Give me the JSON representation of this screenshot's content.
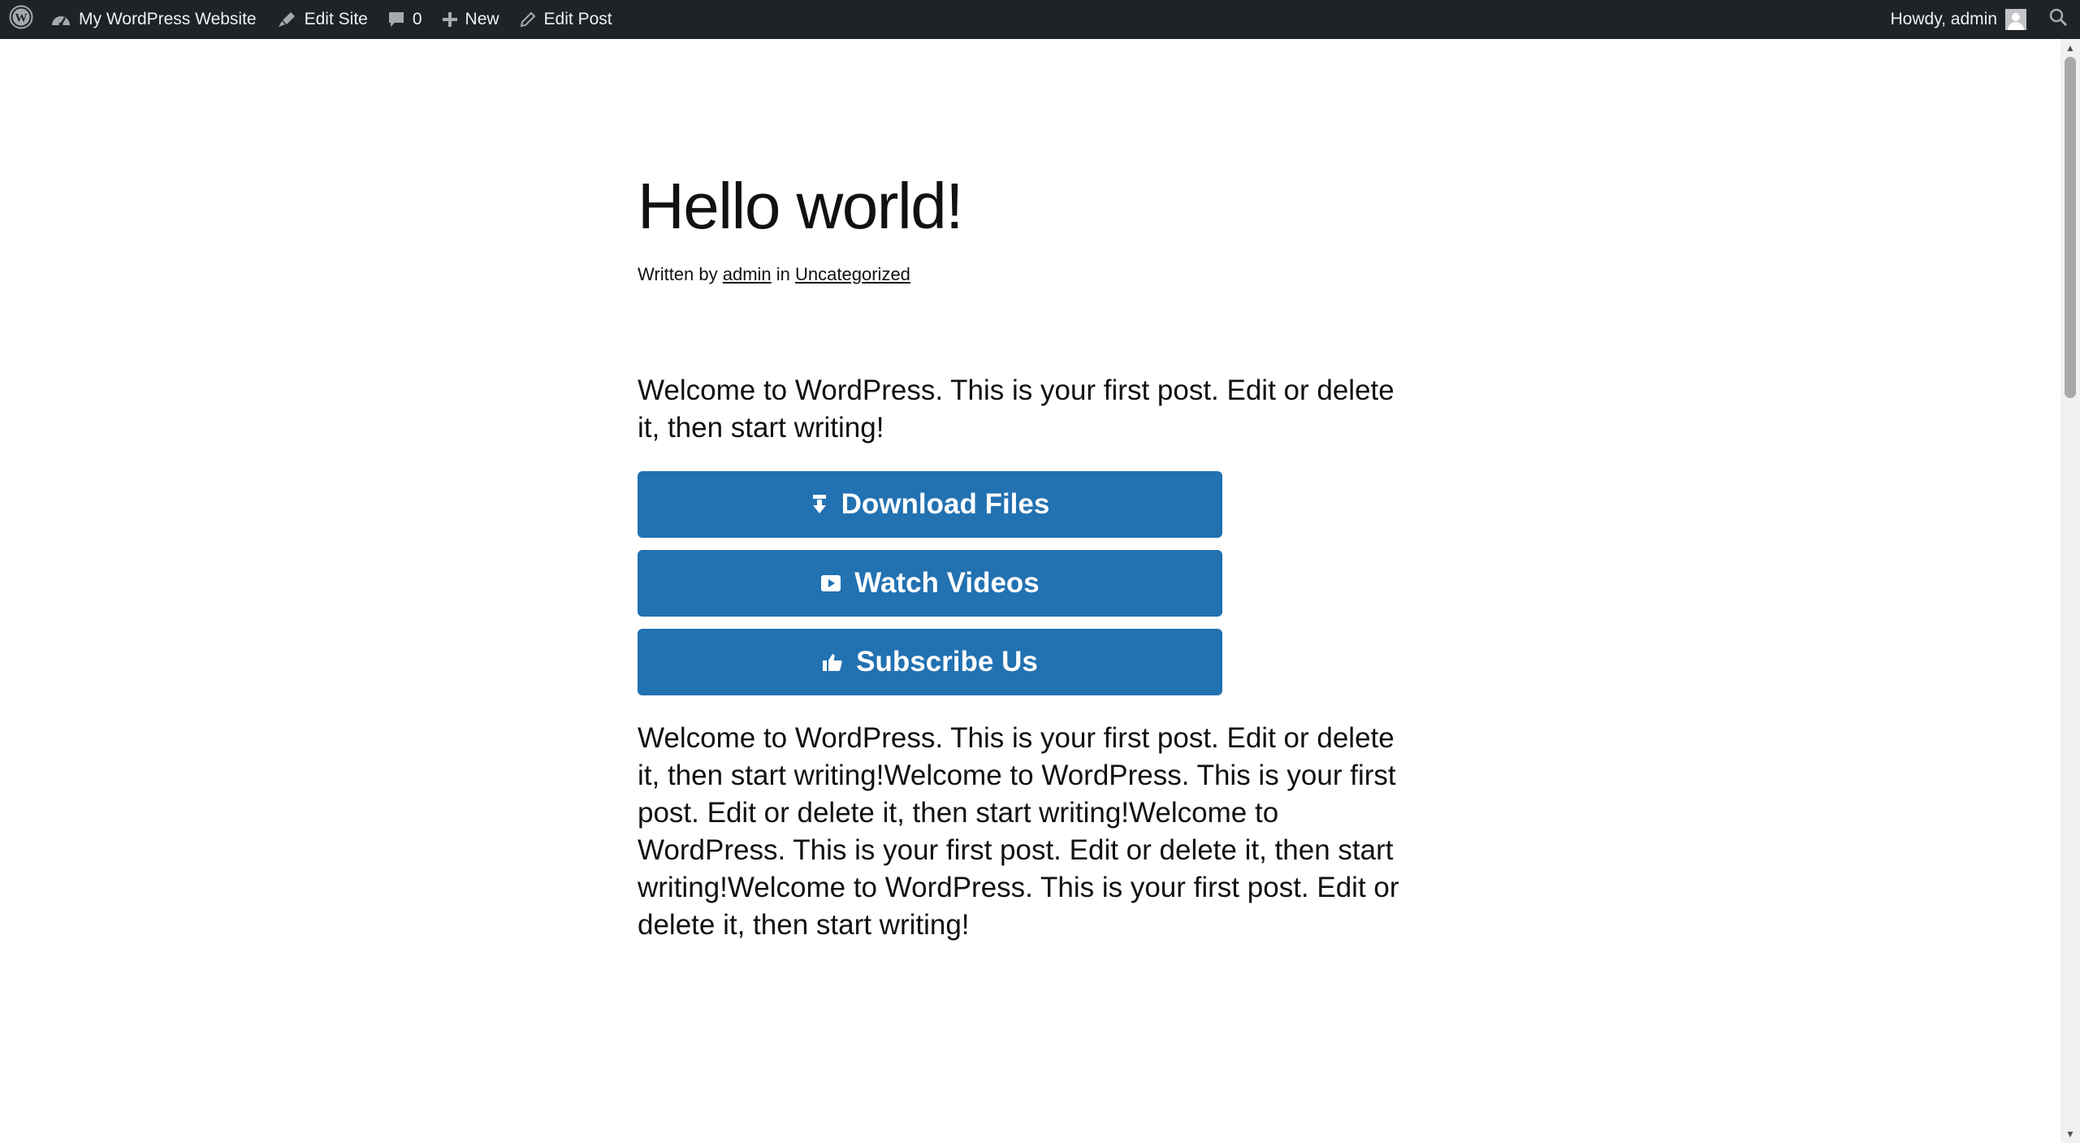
{
  "admin_bar": {
    "site_name": "My WordPress Website",
    "edit_site": "Edit Site",
    "comments_count": "0",
    "new_label": "New",
    "edit_post": "Edit Post",
    "greeting": "Howdy, admin"
  },
  "post": {
    "title": "Hello world!",
    "meta_prefix": "Written by",
    "author": "admin",
    "meta_in": "in",
    "category": "Uncategorized",
    "intro": "Welcome to WordPress. This is your first post. Edit or delete it, then start writing!",
    "body": "Welcome to WordPress. This is your first post. Edit or delete it, then start writing!Welcome to WordPress. This is your first post. Edit or delete it, then start writing!Welcome to WordPress. This is your first post. Edit or delete it, then start writing!Welcome to WordPress. This is your first post. Edit or delete it, then start writing!"
  },
  "buttons": {
    "download": {
      "label": "Download Files",
      "icon": "download-icon"
    },
    "watch": {
      "label": "Watch Videos",
      "icon": "video-icon"
    },
    "subscribe": {
      "label": "Subscribe Us",
      "icon": "thumbs-up-icon"
    }
  },
  "colors": {
    "admin_bar_bg": "#1d2327",
    "button_bg": "#2271b1",
    "text": "#111111"
  }
}
